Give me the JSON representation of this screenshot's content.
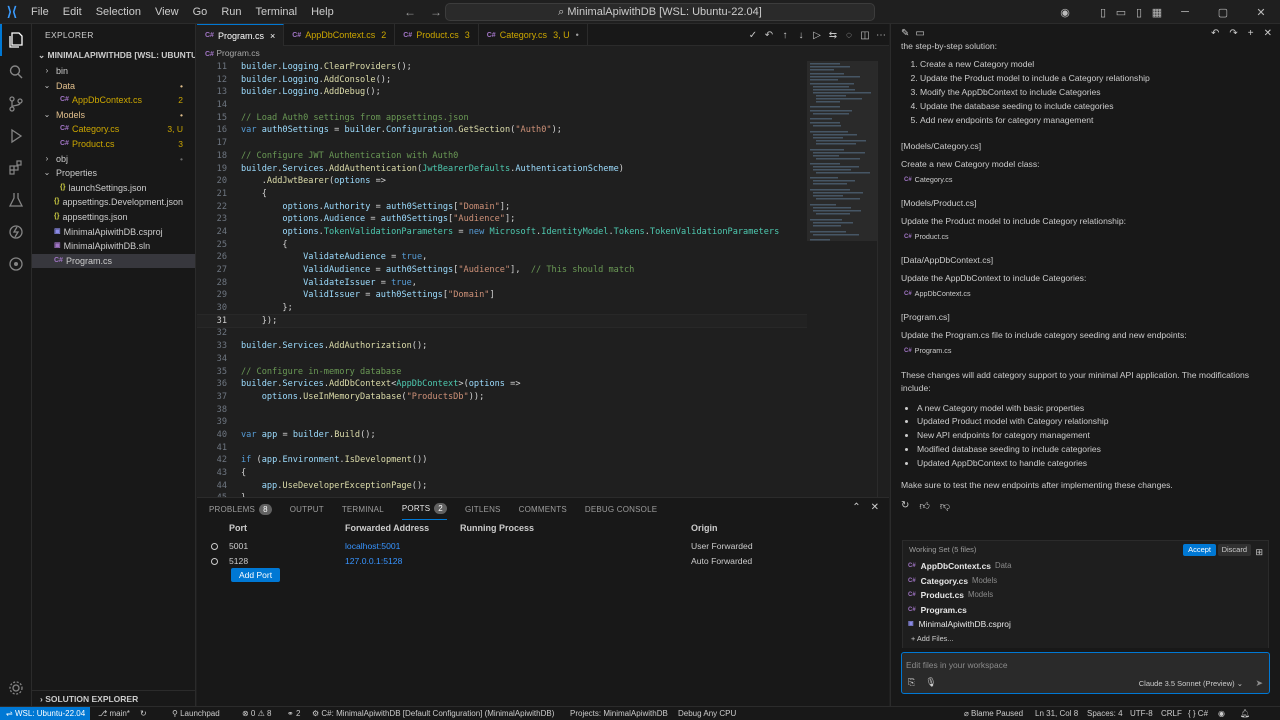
{
  "titlebar": {
    "menu": [
      "File",
      "Edit",
      "Selection",
      "View",
      "Go",
      "Run",
      "Terminal",
      "Help"
    ],
    "command_center": "MinimalApiwithDB [WSL: Ubuntu-22.04]"
  },
  "sidebar": {
    "header": "EXPLORER",
    "project": "MINIMALAPIWITHDB [WSL: UBUNTU-22....",
    "items": [
      {
        "label": "bin",
        "badge": ""
      },
      {
        "label": "Data",
        "badge": ""
      },
      {
        "label": "AppDbContext.cs",
        "badge": "2"
      },
      {
        "label": "Models",
        "badge": ""
      },
      {
        "label": "Category.cs",
        "badge": "3, U"
      },
      {
        "label": "Product.cs",
        "badge": "3"
      },
      {
        "label": "obj",
        "badge": ""
      },
      {
        "label": "Properties",
        "badge": ""
      },
      {
        "label": "launchSettings.json",
        "badge": ""
      },
      {
        "label": "appsettings.Development.json",
        "badge": ""
      },
      {
        "label": "appsettings.json",
        "badge": ""
      },
      {
        "label": "MinimalApiwithDB.csproj",
        "badge": ""
      },
      {
        "label": "MinimalApiwithDB.sln",
        "badge": ""
      },
      {
        "label": "Program.cs",
        "badge": ""
      }
    ],
    "solution_explorer": "SOLUTION EXPLORER"
  },
  "tabs": [
    {
      "label": "Program.cs",
      "suffix": "×"
    },
    {
      "label": "AppDbContext.cs",
      "suffix": "2"
    },
    {
      "label": "Product.cs",
      "suffix": "3"
    },
    {
      "label": "Category.cs",
      "suffix": "3, U"
    }
  ],
  "breadcrumb": "Program.cs",
  "code": [
    {
      "n": "11",
      "t": "builder.Logging.ClearProviders();"
    },
    {
      "n": "12",
      "t": "builder.Logging.AddConsole();"
    },
    {
      "n": "13",
      "t": "builder.Logging.AddDebug();"
    },
    {
      "n": "14",
      "t": ""
    },
    {
      "n": "15",
      "t": "// Load Auth0 settings from appsettings.json"
    },
    {
      "n": "16",
      "t": "var auth0Settings = builder.Configuration.GetSection(\"Auth0\");"
    },
    {
      "n": "17",
      "t": ""
    },
    {
      "n": "18",
      "t": "// Configure JWT Authentication with Auth0"
    },
    {
      "n": "19",
      "t": "builder.Services.AddAuthentication(JwtBearerDefaults.AuthenticationScheme)"
    },
    {
      "n": "20",
      "t": "    .AddJwtBearer(options =>"
    },
    {
      "n": "21",
      "t": "    {"
    },
    {
      "n": "22",
      "t": "        options.Authority = auth0Settings[\"Domain\"];"
    },
    {
      "n": "23",
      "t": "        options.Audience = auth0Settings[\"Audience\"];"
    },
    {
      "n": "24",
      "t": "        options.TokenValidationParameters = new Microsoft.IdentityModel.Tokens.TokenValidationParameters"
    },
    {
      "n": "25",
      "t": "        {"
    },
    {
      "n": "26",
      "t": "            ValidateAudience = true,"
    },
    {
      "n": "27",
      "t": "            ValidAudience = auth0Settings[\"Audience\"],  // This should match"
    },
    {
      "n": "28",
      "t": "            ValidateIssuer = true,"
    },
    {
      "n": "29",
      "t": "            ValidIssuer = auth0Settings[\"Domain\"]"
    },
    {
      "n": "30",
      "t": "        };"
    },
    {
      "n": "31",
      "t": "    });"
    },
    {
      "n": "32",
      "t": ""
    },
    {
      "n": "33",
      "t": "builder.Services.AddAuthorization();"
    },
    {
      "n": "34",
      "t": ""
    },
    {
      "n": "35",
      "t": "// Configure in-memory database"
    },
    {
      "n": "36",
      "t": "builder.Services.AddDbContext<AppDbContext>(options =>"
    },
    {
      "n": "37",
      "t": "    options.UseInMemoryDatabase(\"ProductsDb\"));"
    },
    {
      "n": "38",
      "t": ""
    },
    {
      "n": "39",
      "t": ""
    },
    {
      "n": "40",
      "t": "var app = builder.Build();"
    },
    {
      "n": "41",
      "t": ""
    },
    {
      "n": "42",
      "t": "if (app.Environment.IsDevelopment())"
    },
    {
      "n": "43",
      "t": "{"
    },
    {
      "n": "44",
      "t": "    app.UseDeveloperExceptionPage();"
    },
    {
      "n": "45",
      "t": "}"
    }
  ],
  "panel": {
    "tabs": [
      {
        "label": "PROBLEMS",
        "count": "8"
      },
      {
        "label": "OUTPUT",
        "count": ""
      },
      {
        "label": "TERMINAL",
        "count": ""
      },
      {
        "label": "PORTS",
        "count": "2"
      },
      {
        "label": "GITLENS",
        "count": ""
      },
      {
        "label": "COMMENTS",
        "count": ""
      },
      {
        "label": "DEBUG CONSOLE",
        "count": ""
      }
    ],
    "headers": {
      "port": "Port",
      "address": "Forwarded Address",
      "process": "Running Process",
      "origin": "Origin"
    },
    "rows": [
      {
        "port": "5001",
        "address": "localhost:5001",
        "process": "",
        "origin": "User Forwarded"
      },
      {
        "port": "5128",
        "address": "127.0.0.1:5128",
        "process": "",
        "origin": "Auto Forwarded"
      }
    ],
    "add_port": "Add Port"
  },
  "chat": {
    "intro": "the step-by-step solution:",
    "steps": [
      "Create a new Category model",
      "Update the Product model to include a Category relationship",
      "Modify the AppDbContext to include Categories",
      "Update the database seeding to include categories",
      "Add new endpoints for category management"
    ],
    "sections": [
      {
        "path": "[Models/Category.cs]",
        "desc": "Create a new Category model class:",
        "file": "Category.cs"
      },
      {
        "path": "[Models/Product.cs]",
        "desc": "Update the Product model to include Category relationship:",
        "file": "Product.cs"
      },
      {
        "path": "[Data/AppDbContext.cs]",
        "desc": "Update the AppDbContext to include Categories:",
        "file": "AppDbContext.cs"
      },
      {
        "path": "[Program.cs]",
        "desc": "Update the Program.cs file to include category seeding and new endpoints:",
        "file": "Program.cs"
      }
    ],
    "summary": "These changes will add category support to your minimal API application. The modifications include:",
    "bullets": [
      "A new Category model with basic properties",
      "Updated Product model with Category relationship",
      "New API endpoints for category management",
      "Modified database seeding to include categories",
      "Updated AppDbContext to handle categories"
    ],
    "closing": "Make sure to test the new endpoints after implementing these changes."
  },
  "working_set": {
    "title": "Working Set (5 files)",
    "accept": "Accept",
    "discard": "Discard",
    "files": [
      {
        "name": "AppDbContext.cs",
        "folder": "Data"
      },
      {
        "name": "Category.cs",
        "folder": "Models"
      },
      {
        "name": "Product.cs",
        "folder": "Models"
      },
      {
        "name": "Program.cs",
        "folder": ""
      },
      {
        "name": "MinimalApiwithDB.csproj",
        "folder": ""
      }
    ],
    "add_files": "+ Add Files..."
  },
  "chat_input": {
    "placeholder": "Edit files in your workspace",
    "model": "Claude 3.5 Sonnet (Preview)"
  },
  "statusbar": {
    "remote": "WSL: Ubuntu-22.04",
    "branch": "main*",
    "launchpad": "Launchpad",
    "problems": "⊗ 0 ⚠ 8",
    "ports": "2",
    "project_cfg": "C#: MinimalApiwithDB [Default Configuration] (MinimalApiwithDB)",
    "projects": "Projects: MinimalApiwithDB",
    "debug": "Debug Any CPU",
    "blame": "Blame Paused",
    "position": "Ln 31, Col 8",
    "spaces": "Spaces: 4",
    "encoding": "UTF-8",
    "eol": "CRLF",
    "language": "C#"
  }
}
